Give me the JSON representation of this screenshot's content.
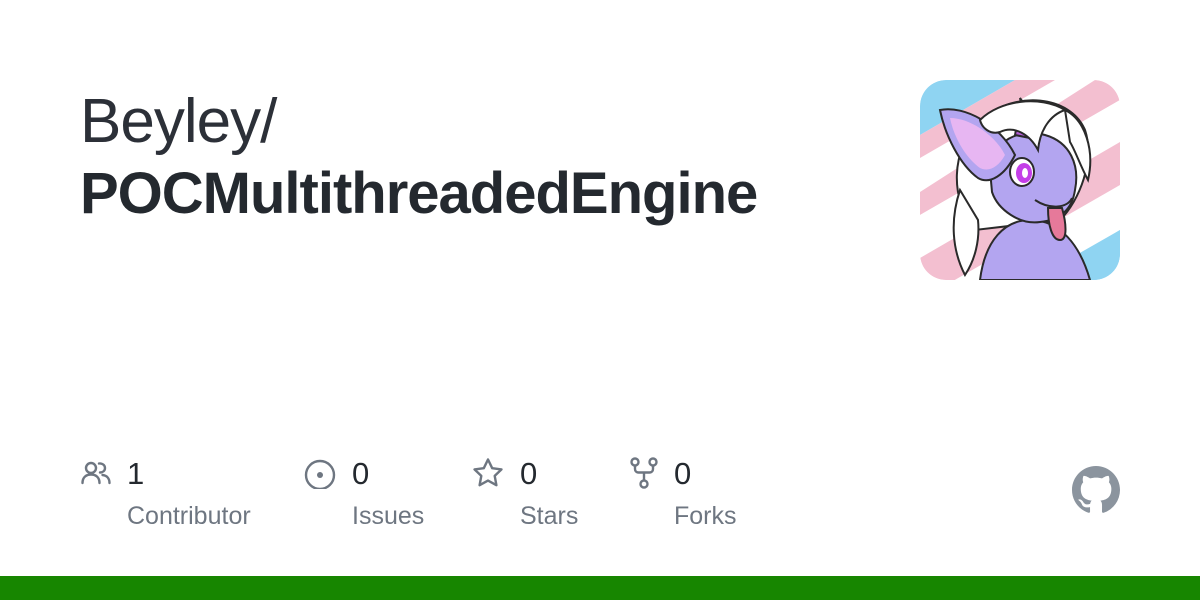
{
  "header": {
    "owner": "Beyley/",
    "repo": "POCMultithreadedEngine"
  },
  "avatar": {
    "icon": "fluffy-dragon-avatar",
    "colors": {
      "stripe_blue": "#8fd4f2",
      "stripe_pink": "#f3bfd0",
      "stripe_white": "#ffffff",
      "body": "#b3a5f0",
      "ear_inner": "#e7b6f2",
      "horn": "#b35bd8",
      "eye": "#c43ee8",
      "tongue": "#e6799a"
    }
  },
  "stats": [
    {
      "icon": "people-icon",
      "value": "1",
      "label": "Contributor"
    },
    {
      "icon": "issue-opened-icon",
      "value": "0",
      "label": "Issues"
    },
    {
      "icon": "star-icon",
      "value": "0",
      "label": "Stars"
    },
    {
      "icon": "repo-forked-icon",
      "value": "0",
      "label": "Forks"
    }
  ],
  "colors": {
    "icon_gray": "#6e7681",
    "language_bar": "#178600",
    "github_logo": "#8b949e"
  }
}
